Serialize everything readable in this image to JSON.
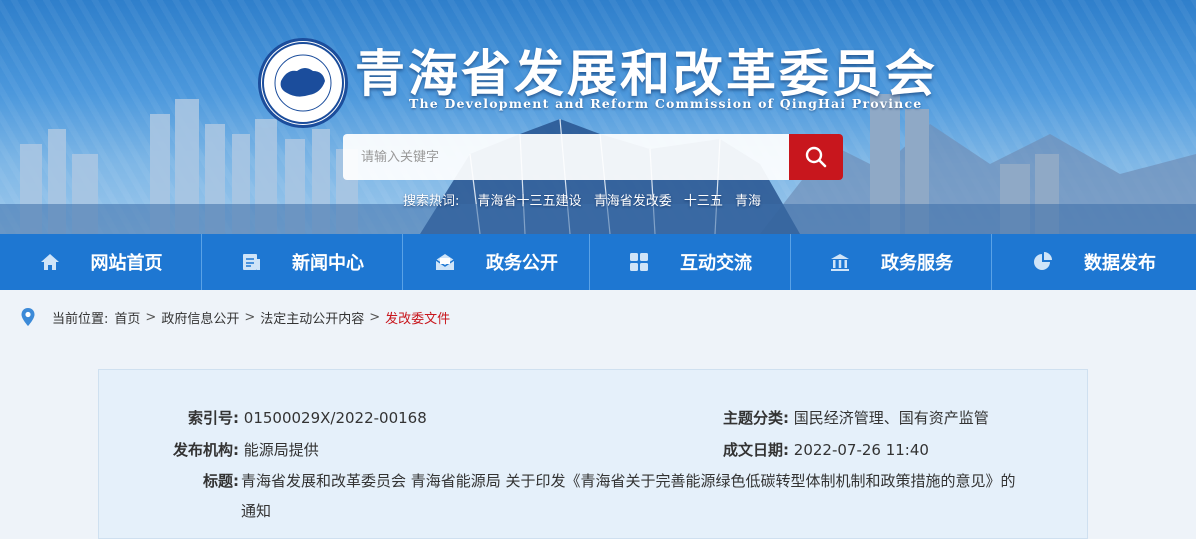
{
  "header": {
    "title": "青海省发展和改革委员会",
    "subtitle": "The Development and Reform Commission of QingHai Province",
    "logo_icon": "emblem-logo"
  },
  "search": {
    "placeholder": "请输入关键字",
    "button_icon": "search-icon",
    "hot_label": "搜索热词:",
    "hot_words": [
      "青海省十三五建设",
      "青海省发改委",
      "十三五",
      "青海"
    ]
  },
  "nav": {
    "items": [
      {
        "label": "网站首页",
        "icon": "home-icon"
      },
      {
        "label": "新闻中心",
        "icon": "news-icon"
      },
      {
        "label": "政务公开",
        "icon": "mail-icon"
      },
      {
        "label": "互动交流",
        "icon": "grid-icon"
      },
      {
        "label": "政务服务",
        "icon": "building-icon"
      },
      {
        "label": "数据发布",
        "icon": "pie-chart-icon"
      }
    ]
  },
  "breadcrumb": {
    "prefix": "当前位置:",
    "items": [
      "首页",
      "政府信息公开",
      "法定主动公开内容",
      "发改委文件"
    ]
  },
  "info": {
    "index_label": "索引号:",
    "index_value": "01500029X/2022-00168",
    "topic_label": "主题分类:",
    "topic_value": "国民经济管理、国有资产监管",
    "publisher_label": "发布机构:",
    "publisher_value": "能源局提供",
    "date_label": "成文日期:",
    "date_value": "2022-07-26 11:40",
    "title_label": "标题:",
    "title_value": "青海省发展和改革委员会 青海省能源局 关于印发《青海省关于完善能源绿色低碳转型体制机制和政策措施的意见》的通知"
  },
  "colors": {
    "nav_bg": "#1e77d2",
    "search_button": "#c8161d",
    "breadcrumb_current": "#c8161d",
    "panel_bg": "#e5f0fa"
  }
}
